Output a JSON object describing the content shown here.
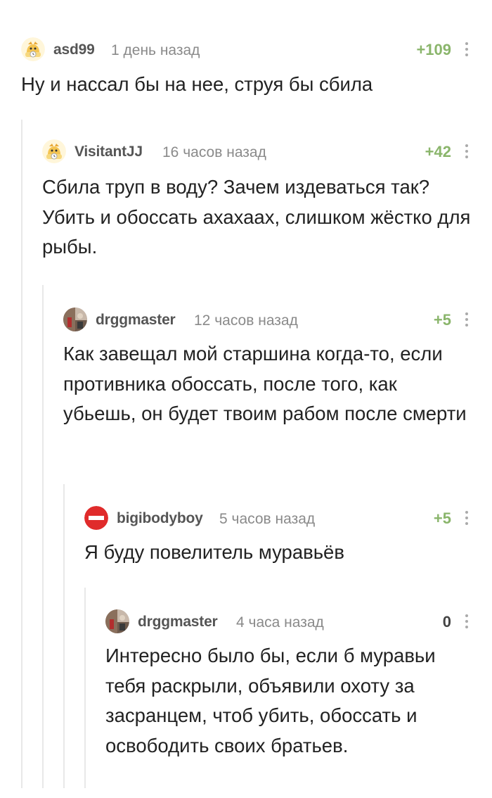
{
  "comments": [
    {
      "username": "asd99",
      "time": "1 день назад",
      "rating": "+109",
      "avatar": "hamster-placeholder-avatar",
      "text": "Ну и нассал бы на нее, струя бы сбила"
    },
    {
      "username": "VisitantJJ",
      "time": "16 часов назад",
      "rating": "+42",
      "avatar": "hamster-placeholder-avatar",
      "text": "Сбила труп в воду? Зачем издеваться так? Убить и обоссать ахахаах, слишком жёстко для рыбы."
    },
    {
      "username": "drggmaster",
      "time": "12 часов назад",
      "rating": "+5",
      "avatar": "photo-avatar",
      "text": "Как завещал мой старшина когда-то, если противника обоссать, после того, как убьешь, он будет твоим рабом после смерти"
    },
    {
      "username": "bigibodyboy",
      "time": "5 часов назад",
      "rating": "+5",
      "avatar": "no-entry-sign-avatar",
      "text": "Я буду повелитель муравьёв"
    },
    {
      "username": "drggmaster",
      "time": "4 часа назад",
      "rating": "0",
      "avatar": "photo-avatar",
      "text": "Интересно было бы, если б муравьи тебя раскрыли, объявили охоту за засранцем, чтоб убить, обоссать и освободить своих братьев."
    }
  ],
  "colors": {
    "positive_rating": "#8ab56b",
    "thread_line": "#e8e8e8",
    "no_entry_red": "#e02b2b"
  }
}
